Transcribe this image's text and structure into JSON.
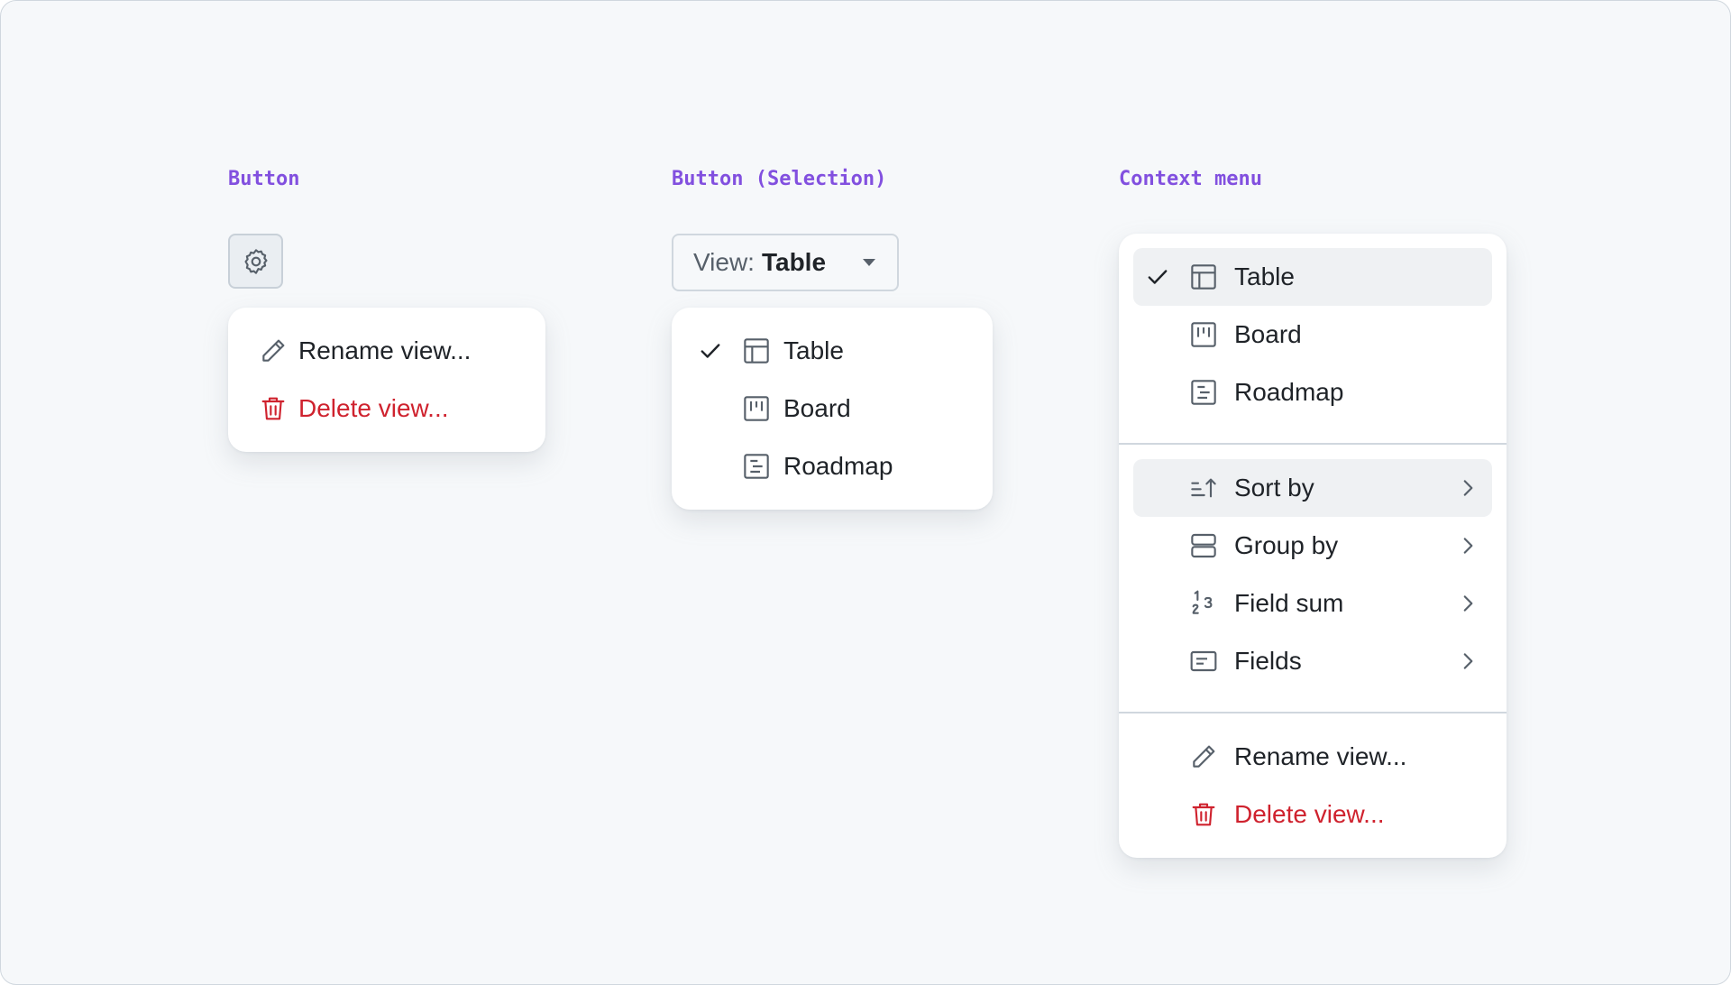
{
  "sections": {
    "button": {
      "heading": "Button",
      "icon": "gear-icon",
      "menu": [
        {
          "label": "Rename view...",
          "icon": "pencil-icon"
        },
        {
          "label": "Delete view...",
          "icon": "trash-icon",
          "color": "#cf222e"
        }
      ]
    },
    "selection": {
      "heading": "Button (Selection)",
      "button_prefix": "View:",
      "button_value": "Table",
      "caret_icon": "triangle-down-icon",
      "menu": [
        {
          "label": "Table",
          "icon": "table-icon",
          "selected": true
        },
        {
          "label": "Board",
          "icon": "board-icon"
        },
        {
          "label": "Roadmap",
          "icon": "roadmap-icon"
        }
      ]
    },
    "context": {
      "heading": "Context menu",
      "views": [
        {
          "label": "Table",
          "icon": "table-icon",
          "selected": true
        },
        {
          "label": "Board",
          "icon": "board-icon"
        },
        {
          "label": "Roadmap",
          "icon": "roadmap-icon"
        }
      ],
      "options": [
        {
          "label": "Sort by",
          "icon": "sort-asc-icon",
          "submenu": true,
          "highlighted": true
        },
        {
          "label": "Group by",
          "icon": "rows-icon",
          "submenu": true
        },
        {
          "label": "Field sum",
          "icon": "number-icon",
          "submenu": true
        },
        {
          "label": "Fields",
          "icon": "note-icon",
          "submenu": true
        }
      ],
      "actions": [
        {
          "label": "Rename view...",
          "icon": "pencil-icon"
        },
        {
          "label": "Delete view...",
          "icon": "trash-icon",
          "color": "#cf222e"
        }
      ]
    }
  },
  "colors": {
    "heading": "#8250df",
    "icon": "#57606a",
    "danger": "#cf222e",
    "text": "#1f2328",
    "highlight": "#eff1f3",
    "background": "#f6f8fa"
  }
}
